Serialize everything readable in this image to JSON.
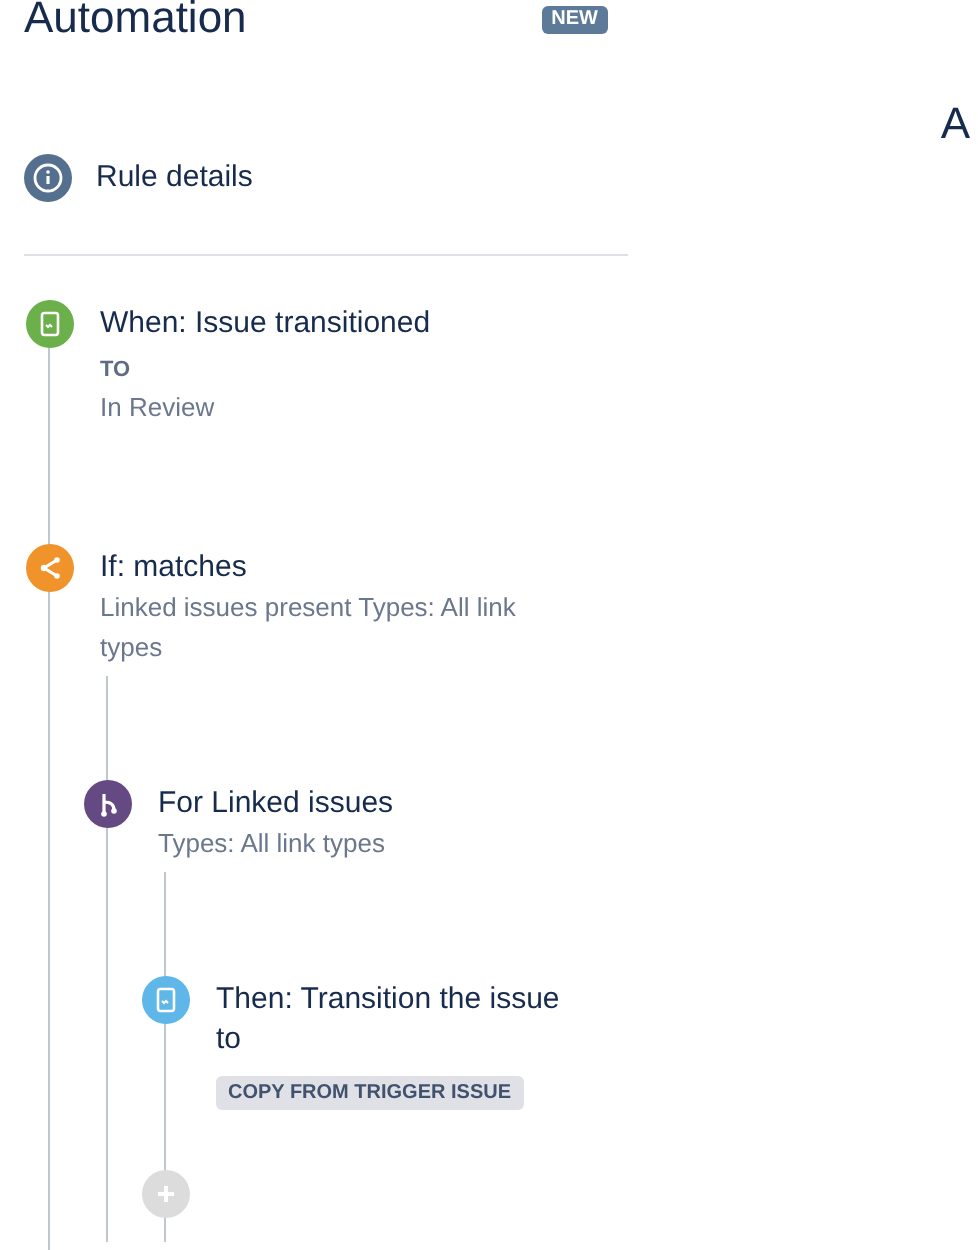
{
  "title": "Automation",
  "badge": "NEW",
  "right_heading": "A",
  "rule_details": {
    "label": "Rule details"
  },
  "steps": [
    {
      "kind": "when",
      "color": "#6bb04a",
      "title": "When: Issue transitioned",
      "details": [
        {
          "kind": "label",
          "text": "TO"
        },
        {
          "kind": "text",
          "text": "In Review"
        }
      ]
    },
    {
      "kind": "if",
      "color": "#f0932b",
      "title": "If: matches",
      "details": [
        {
          "kind": "text",
          "text": "Linked issues present Types: All link types"
        }
      ],
      "children": [
        {
          "kind": "branch",
          "color": "#654982",
          "title": "For Linked issues",
          "details": [
            {
              "kind": "text",
              "text": "Types: All link types"
            }
          ],
          "children": [
            {
              "kind": "then",
              "color": "#5fb6e8",
              "title": "Then: Transition the issue to",
              "details": [
                {
                  "kind": "tag",
                  "text": "COPY FROM TRIGGER ISSUE"
                }
              ]
            },
            {
              "kind": "add"
            }
          ]
        }
      ]
    }
  ]
}
